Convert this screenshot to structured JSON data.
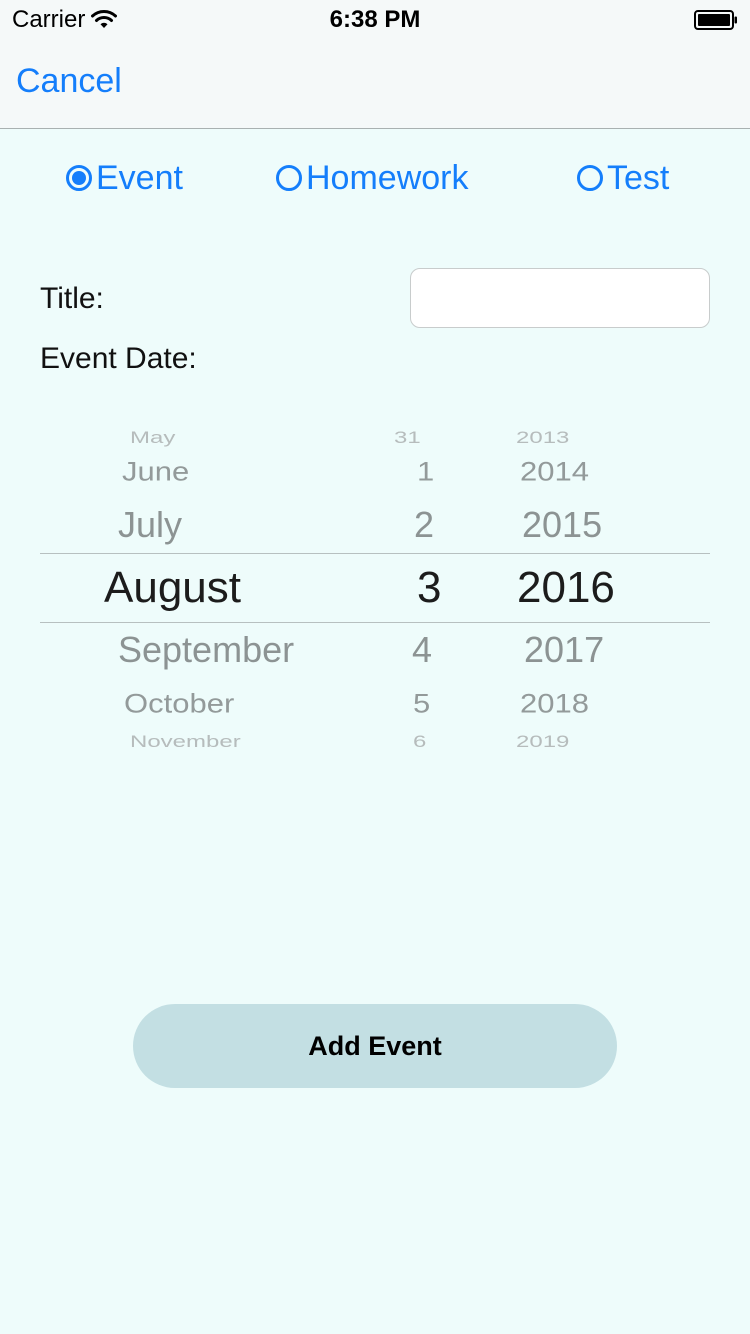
{
  "status_bar": {
    "carrier": "Carrier",
    "time": "6:38 PM"
  },
  "nav": {
    "cancel_label": "Cancel"
  },
  "segment": {
    "options": [
      {
        "label": "Event",
        "selected": true
      },
      {
        "label": "Homework",
        "selected": false
      },
      {
        "label": "Test",
        "selected": false
      }
    ]
  },
  "form": {
    "title_label": "Title:",
    "title_value": "",
    "date_label": "Event Date:"
  },
  "date_picker": {
    "months": [
      "May",
      "June",
      "July",
      "August",
      "September",
      "October",
      "November"
    ],
    "days": [
      "31",
      "1",
      "2",
      "3",
      "4",
      "5",
      "6"
    ],
    "years": [
      "2013",
      "2014",
      "2015",
      "2016",
      "2017",
      "2018",
      "2019"
    ],
    "selected": {
      "month": "August",
      "day": "3",
      "year": "2016"
    }
  },
  "colors": {
    "accent": "#147efb",
    "background": "#eefcfb",
    "button_bg": "#c3dfe3"
  },
  "add_button": {
    "label": "Add Event"
  }
}
